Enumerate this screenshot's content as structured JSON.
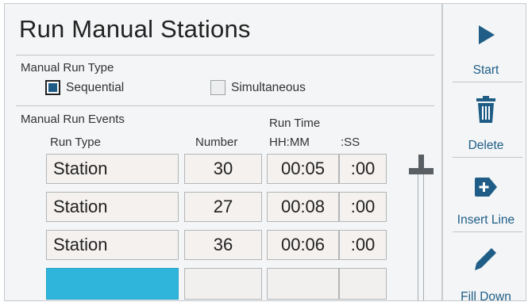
{
  "title": "Run Manual Stations",
  "run_type": {
    "label": "Manual Run Type",
    "options": [
      {
        "label": "Sequential",
        "checked": true
      },
      {
        "label": "Simultaneous",
        "checked": false
      }
    ]
  },
  "events": {
    "label": "Manual Run Events",
    "columns": {
      "run_type": "Run Type",
      "number": "Number",
      "run_time": "Run Time",
      "hhmm": "HH:MM",
      "ss": ":SS"
    },
    "rows": [
      {
        "type": "Station",
        "number": "30",
        "time": "00:05",
        "sec": ":00"
      },
      {
        "type": "Station",
        "number": "27",
        "time": "00:08",
        "sec": ":00"
      },
      {
        "type": "Station",
        "number": "36",
        "time": "00:06",
        "sec": ":00"
      },
      {
        "type": "",
        "number": "",
        "time": "",
        "sec": ""
      }
    ]
  },
  "sidebar": {
    "start": {
      "label": "Start",
      "icon": "play-icon"
    },
    "delete": {
      "label": "Delete",
      "icon": "trash-icon"
    },
    "insert": {
      "label": "Insert Line",
      "icon": "insert-tag-icon"
    },
    "fill": {
      "label": "Fill Down",
      "icon": "pencil-icon"
    }
  },
  "colors": {
    "accent": "#1f5d87",
    "selected_cell": "#2fb5dc"
  }
}
